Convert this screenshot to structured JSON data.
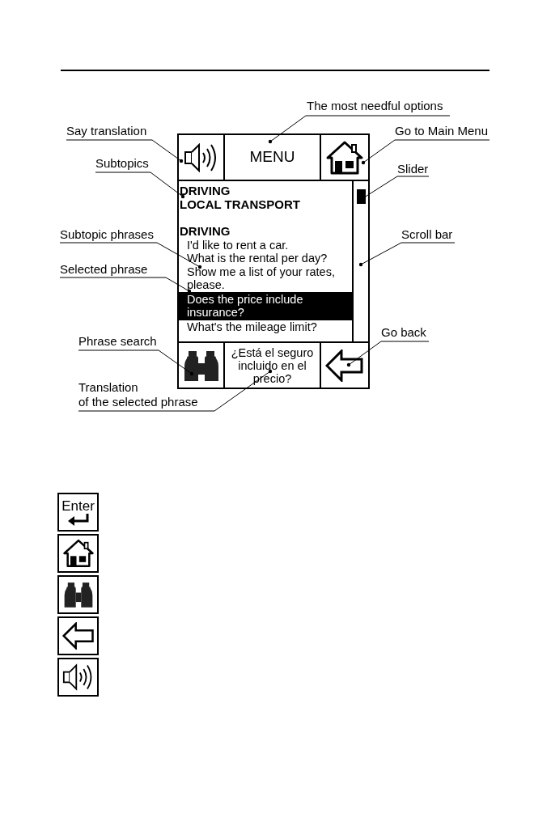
{
  "callouts": [
    {
      "text": "The most needful options"
    },
    {
      "text": "Say translation"
    },
    {
      "text": "Go to Main Menu"
    },
    {
      "text": "Subtopics"
    },
    {
      "text": "Slider"
    },
    {
      "text": "Subtopic phrases"
    },
    {
      "text": "Scroll bar"
    },
    {
      "text": "Selected phrase"
    },
    {
      "text": "Go back"
    },
    {
      "text": "Phrase search"
    },
    {
      "text": "Translation\nof the selected phrase"
    }
  ],
  "device": {
    "menu_label": "MENU",
    "subtopics": [
      "DRIVING",
      "LOCAL TRANSPORT"
    ],
    "section_heading": "DRIVING",
    "phrases": [
      {
        "text": "I'd like to rent a car.",
        "selected": false
      },
      {
        "text": "What is the rental per day?",
        "selected": false
      },
      {
        "text": "Show me a list of your rates, please.",
        "selected": false
      },
      {
        "text": "Does the price include insurance?",
        "selected": true
      },
      {
        "text": "What's the mileage limit?",
        "selected": false
      }
    ],
    "translation": "¿Está el seguro incluido en el precio?"
  },
  "legend": [
    {
      "kind": "enter",
      "label": "Enter"
    },
    {
      "kind": "home"
    },
    {
      "kind": "search"
    },
    {
      "kind": "back"
    },
    {
      "kind": "speaker"
    }
  ]
}
